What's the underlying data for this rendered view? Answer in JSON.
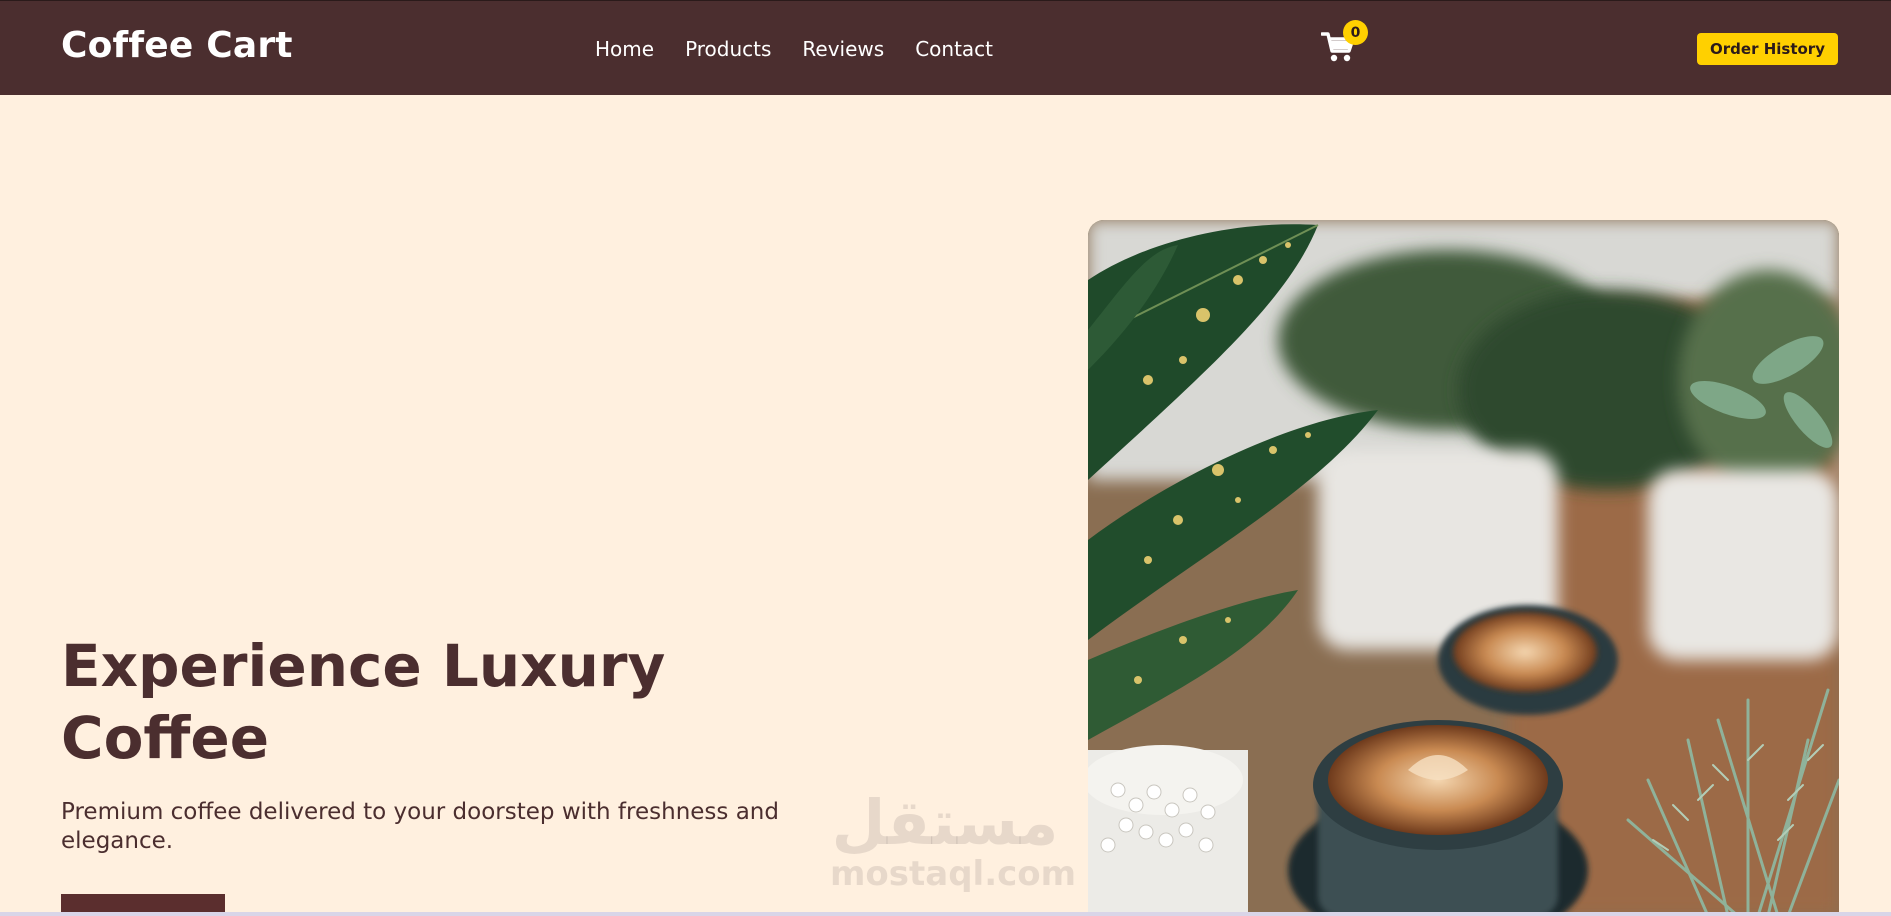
{
  "brand": "Coffee Cart",
  "nav": [
    {
      "label": "Home"
    },
    {
      "label": "Products"
    },
    {
      "label": "Reviews"
    },
    {
      "label": "Contact"
    }
  ],
  "cart": {
    "icon": "cart-icon",
    "count": "0"
  },
  "order_history_label": "Order History",
  "hero": {
    "title": "Experience Luxury Coffee",
    "subtitle": "Premium coffee delivered to your doorstep with freshness and elegance.",
    "image_alt": "Coffee cups with latte art surrounded by green potted plants"
  },
  "watermark": {
    "logo": "مستقل",
    "text": "mostaql.com"
  },
  "colors": {
    "navbar": "#4b2e2f",
    "page_background": "#fff0df",
    "accent": "#ffd000",
    "heading": "#4b2e2f"
  }
}
